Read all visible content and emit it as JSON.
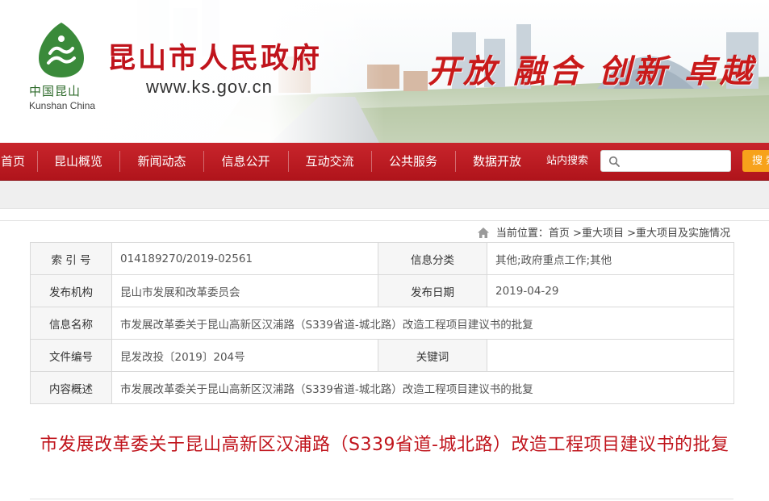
{
  "header": {
    "site_title": "昆山市人民政府",
    "site_url": "www.ks.gov.cn",
    "logo_cn": "中国昆山",
    "logo_en": "Kunshan China",
    "slogan": "开放 融合 创新 卓越",
    "brand_color": "#c0141c",
    "logo_color": "#3a8a3a"
  },
  "nav": {
    "items": [
      "首页",
      "昆山概览",
      "新闻动态",
      "信息公开",
      "互动交流",
      "公共服务",
      "数据开放"
    ],
    "search_label": "站内搜索",
    "search_placeholder": "",
    "search_button": "搜索",
    "search_button_color": "#f7a21b",
    "nav_color": "#b8181f"
  },
  "breadcrumb": {
    "prefix": "当前位置：",
    "items": [
      "首页",
      ">重大项目",
      ">重大项目及实施情况"
    ]
  },
  "info": {
    "rows": [
      {
        "label": "索 引 号",
        "value": "014189270/2019-02561",
        "label2": "信息分类",
        "value2": "其他;政府重点工作;其他"
      },
      {
        "label": "发布机构",
        "value": "昆山市发展和改革委员会",
        "label2": "发布日期",
        "value2": "2019-04-29"
      },
      {
        "label": "信息名称",
        "value": "市发展改革委关于昆山高新区汉浦路（S339省道-城北路）改造工程项目建议书的批复"
      },
      {
        "label": "文件编号",
        "value": "昆发改投〔2019〕204号",
        "label2": "关键词",
        "value2": ""
      },
      {
        "label": "内容概述",
        "value": "市发展改革委关于昆山高新区汉浦路（S339省道-城北路）改造工程项目建议书的批复"
      }
    ]
  },
  "article": {
    "title": "市发展改革委关于昆山高新区汉浦路（S339省道-城北路）改造工程项目建议书的批复"
  }
}
